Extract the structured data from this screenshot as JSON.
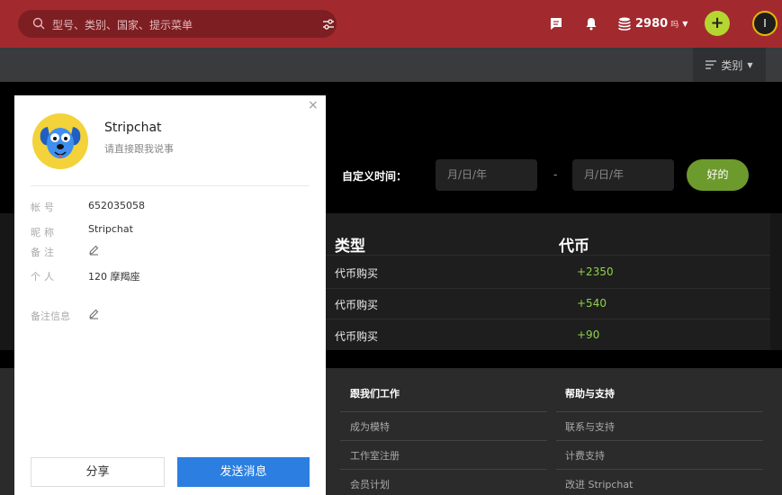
{
  "topbar": {
    "search_placeholder": "型号、类别、国家、提示菜单",
    "token_amount": "2980",
    "token_unit": "吗",
    "plus": "+",
    "avatar_initial": "I"
  },
  "subbar": {
    "category_label": "类别"
  },
  "filter": {
    "custom_time_label": "自定义时间：",
    "date_placeholder": "月/日/年",
    "separator": "-",
    "ok_label": "好的"
  },
  "table": {
    "col_type": "类型",
    "col_tokens": "代币",
    "rows": [
      {
        "type": "代币购买",
        "tokens": "+2350"
      },
      {
        "type": "代币购买",
        "tokens": "+540"
      },
      {
        "type": "代币购买",
        "tokens": "+90"
      }
    ]
  },
  "footer": {
    "col1_title": "跟我们工作",
    "col1_links": [
      "成为模特",
      "工作室注册",
      "会员计划"
    ],
    "col2_title": "帮助与支持",
    "col2_links": [
      "联系与支持",
      "计费支持",
      "改进 Stripchat"
    ]
  },
  "modal": {
    "close": "×",
    "name": "Stripchat",
    "subtitle": "请直接跟我说事",
    "account_label": "帐号",
    "account_value": "652035058",
    "nickname_label": "昵称",
    "nickname_value": "Stripchat",
    "remark_label": "备注",
    "personal_label": "个人",
    "personal_value": "120 摩羯座",
    "remark_info_label": "备注信息",
    "share_label": "分享",
    "send_label": "发送消息"
  },
  "colors": {
    "topbar": "#a22a2f",
    "accent_green": "#b5d630",
    "ok_green": "#6d9a2c",
    "token_green": "#8fd14b",
    "send_blue": "#2c7fe0"
  }
}
